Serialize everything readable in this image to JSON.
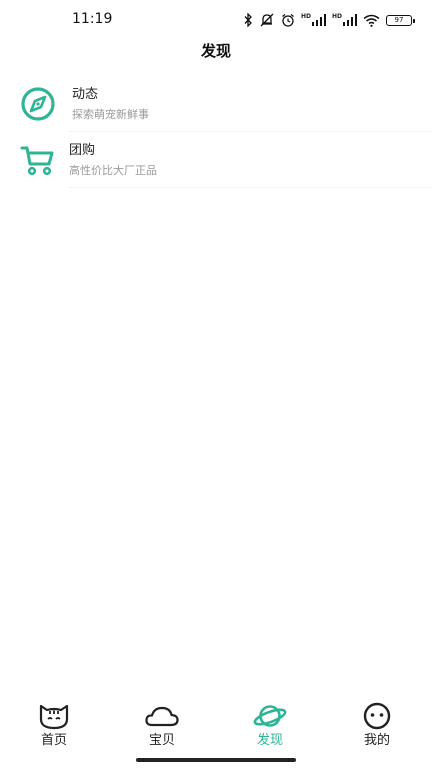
{
  "status": {
    "time": "11:19",
    "battery": "97",
    "hd1": "HD",
    "hd2": "HD"
  },
  "header": {
    "title": "发现"
  },
  "colors": {
    "accent": "#2fb596",
    "text": "#222222",
    "subtext": "#9a9a9a"
  },
  "list": [
    {
      "icon": "compass-icon",
      "title": "动态",
      "subtitle": "探索萌宠新鲜事"
    },
    {
      "icon": "cart-icon",
      "title": "团购",
      "subtitle": "高性价比大厂正品"
    }
  ],
  "tabs": [
    {
      "icon": "cat-face-icon",
      "label": "首页",
      "active": false
    },
    {
      "icon": "cloud-icon",
      "label": "宝贝",
      "active": false
    },
    {
      "icon": "planet-icon",
      "label": "发现",
      "active": true
    },
    {
      "icon": "smiley-face-icon",
      "label": "我的",
      "active": false
    }
  ]
}
